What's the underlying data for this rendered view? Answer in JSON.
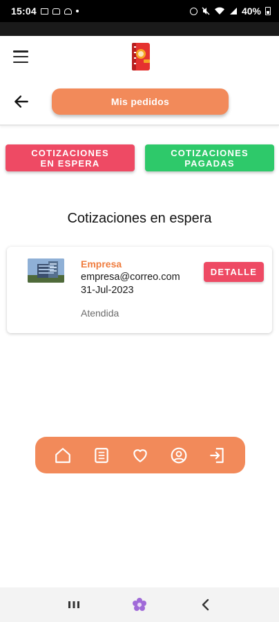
{
  "status_bar": {
    "time": "15:04",
    "battery": "40%",
    "icons": [
      "gallery-icon",
      "notification-icon",
      "cloud-icon",
      "dot-icon",
      "alarm-icon",
      "mute-icon",
      "wifi-icon",
      "signal-icon",
      "battery-icon"
    ]
  },
  "header": {
    "menu_icon": "hamburger-menu-icon",
    "logo": "notebook-logo"
  },
  "nav": {
    "back_icon": "arrow-left-icon",
    "title": "Mis pedidos"
  },
  "tabs": [
    {
      "label": "COTIZACIONES EN ESPERA",
      "color": "#ee4a64"
    },
    {
      "label": "COTIZACIONES PAGADAS",
      "color": "#2ec96a"
    }
  ],
  "section_title": "Cotizaciones en espera",
  "orders": [
    {
      "company": "Empresa",
      "email": "empresa@correo.com",
      "date": "31-Jul-2023",
      "status": "Atendida",
      "detail_label": "DETALLE",
      "thumbnail": "building-thumbnail"
    }
  ],
  "bottom_nav": [
    {
      "icon": "home-icon"
    },
    {
      "icon": "list-icon"
    },
    {
      "icon": "heart-icon"
    },
    {
      "icon": "user-icon"
    },
    {
      "icon": "logout-icon"
    }
  ],
  "system_nav": [
    "recents-icon",
    "home-flower-icon",
    "back-icon"
  ],
  "colors": {
    "accent": "#f28a5a",
    "waiting": "#ee4a64",
    "paid": "#2ec96a",
    "company_text": "#ef7c3e"
  }
}
